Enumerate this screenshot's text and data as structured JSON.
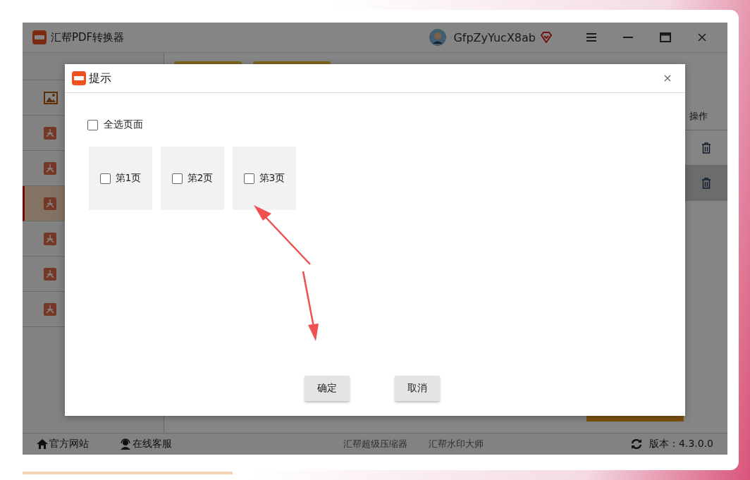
{
  "app": {
    "title": "汇帮PDF转换器",
    "user": "GfpZyYucX8ab"
  },
  "sidebar": {
    "items": [
      {
        "kind": "image",
        "selected": false
      },
      {
        "kind": "pdf",
        "selected": false
      },
      {
        "kind": "pdf",
        "selected": false
      },
      {
        "kind": "pdf",
        "selected": true
      },
      {
        "kind": "pdf",
        "selected": false
      },
      {
        "kind": "pdf",
        "selected": false
      },
      {
        "kind": "pdf",
        "selected": false
      }
    ]
  },
  "table": {
    "column_header": "操作",
    "rows": [
      {
        "selected": false
      },
      {
        "selected": true
      }
    ]
  },
  "footer": {
    "links": [
      {
        "kind": "home",
        "label": "官方网站"
      },
      {
        "kind": "support",
        "label": "在线客服"
      }
    ],
    "products": [
      "汇帮超级压缩器",
      "汇帮水印大师"
    ],
    "version": "版本：4.3.0.0"
  },
  "dialog": {
    "title": "提示",
    "select_all": {
      "label": "全选页面",
      "checked": false
    },
    "pages": [
      {
        "label": "第1页",
        "checked": false
      },
      {
        "label": "第2页",
        "checked": false
      },
      {
        "label": "第3页",
        "checked": false
      }
    ],
    "buttons": [
      {
        "label": "确定"
      },
      {
        "label": "取消"
      }
    ]
  }
}
